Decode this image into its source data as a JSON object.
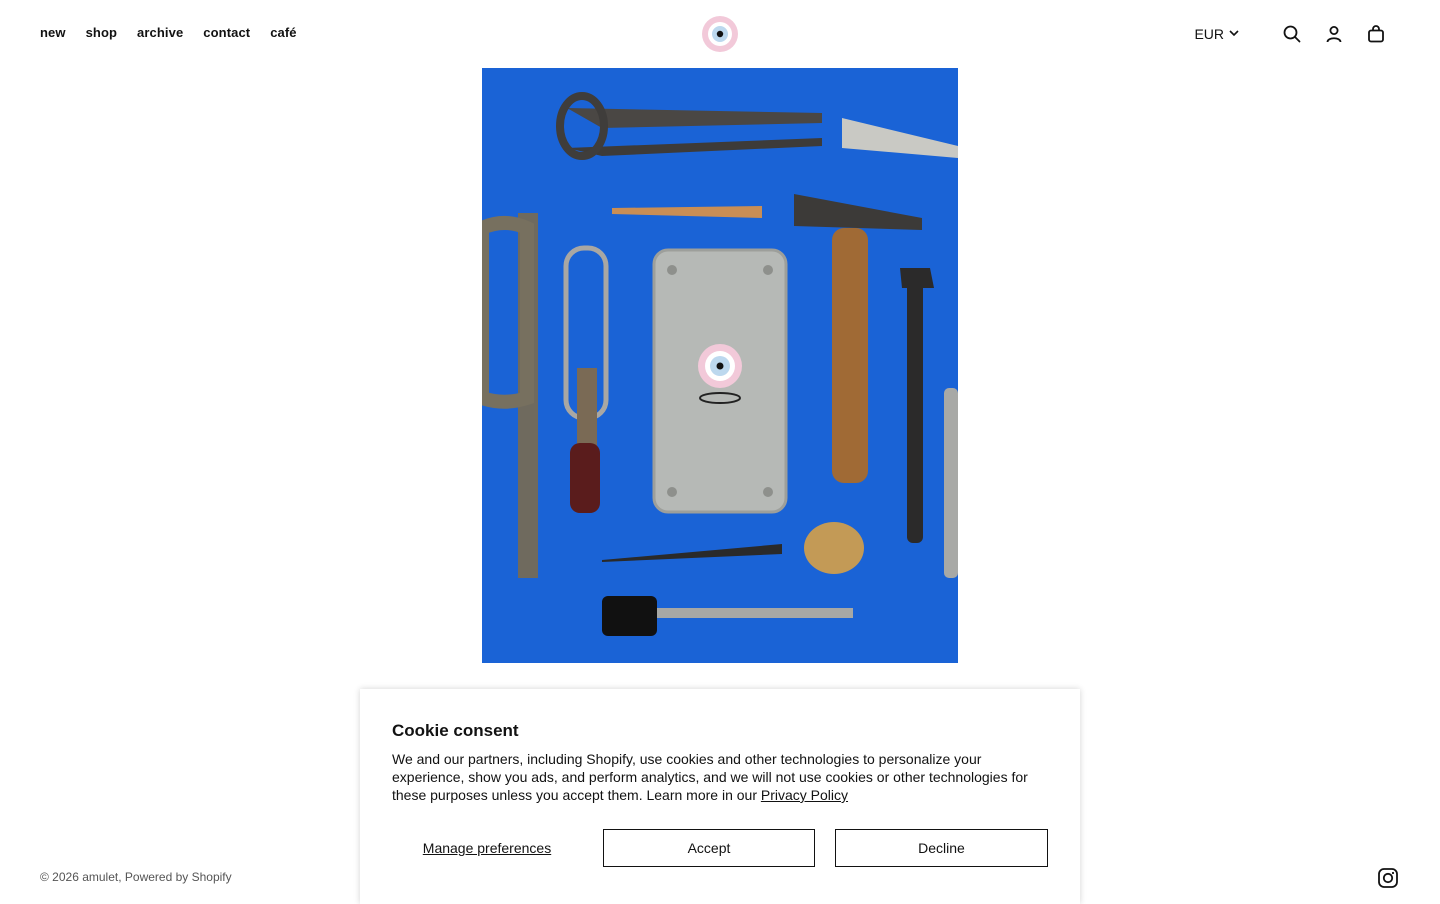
{
  "nav": {
    "items": [
      {
        "label": "new"
      },
      {
        "label": "shop"
      },
      {
        "label": "archive"
      },
      {
        "label": "contact"
      },
      {
        "label": "café"
      }
    ]
  },
  "header": {
    "logo_icon": "eye-amulet-logo",
    "currency": "EUR",
    "icons": [
      "search-icon",
      "account-icon",
      "cart-icon"
    ]
  },
  "hero": {
    "background_color": "#1a63d6",
    "description_icons": [
      "toolbox",
      "pliers",
      "hammer",
      "wrench",
      "file",
      "screwdriver",
      "awl",
      "pencil"
    ]
  },
  "footer": {
    "copyright": "© 2026 amulet, Powered by Shopify",
    "social_icon": "instagram-icon"
  },
  "cookie": {
    "title": "Cookie consent",
    "body": "We and our partners, including Shopify, use cookies and other technologies to personalize your experience, show you ads, and perform analytics, and we will not use cookies or other technologies for these purposes unless you accept them. Learn more in our ",
    "privacy_link": "Privacy Policy",
    "manage_label": "Manage preferences",
    "accept_label": "Accept",
    "decline_label": "Decline"
  },
  "colors": {
    "brand_pink": "#f2c9d9",
    "brand_blue": "#bcd8ee",
    "hero_blue": "#1a63d6"
  }
}
